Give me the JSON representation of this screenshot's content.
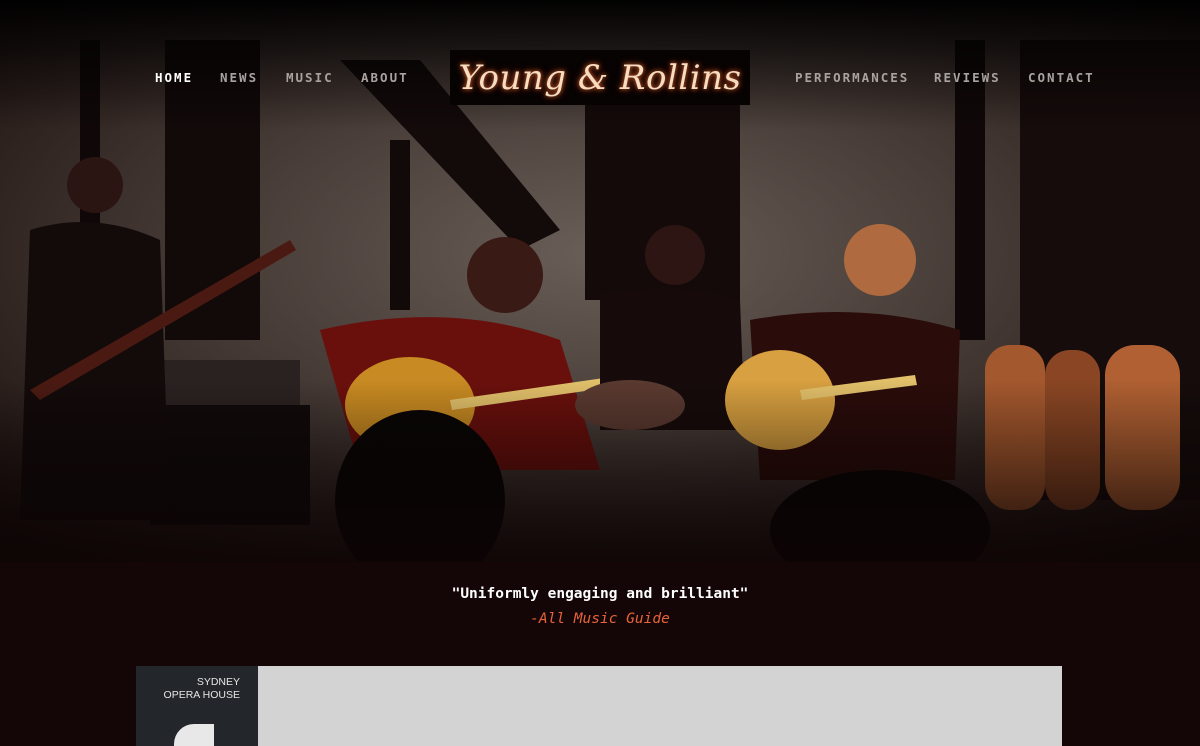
{
  "nav": {
    "left": [
      "HOME",
      "NEWS",
      "MUSIC",
      "ABOUT"
    ],
    "right": [
      "PERFORMANCES",
      "REVIEWS",
      "CONTACT"
    ],
    "active": "HOME"
  },
  "logo": {
    "text": "Young & Rollins"
  },
  "hero": {
    "image": "concert photo of band performing on stage with guitars and congas"
  },
  "testimonial": {
    "quote": "\"Uniformly engaging and brilliant\"",
    "attribution": "-All Music Guide"
  },
  "promo": {
    "poster_text": "SYDNEY\nOPERA HOUSE"
  },
  "colors": {
    "background": "#140606",
    "accent": "#e8623a",
    "nav_inactive": "#a8a39e",
    "nav_active": "#ffffff"
  }
}
